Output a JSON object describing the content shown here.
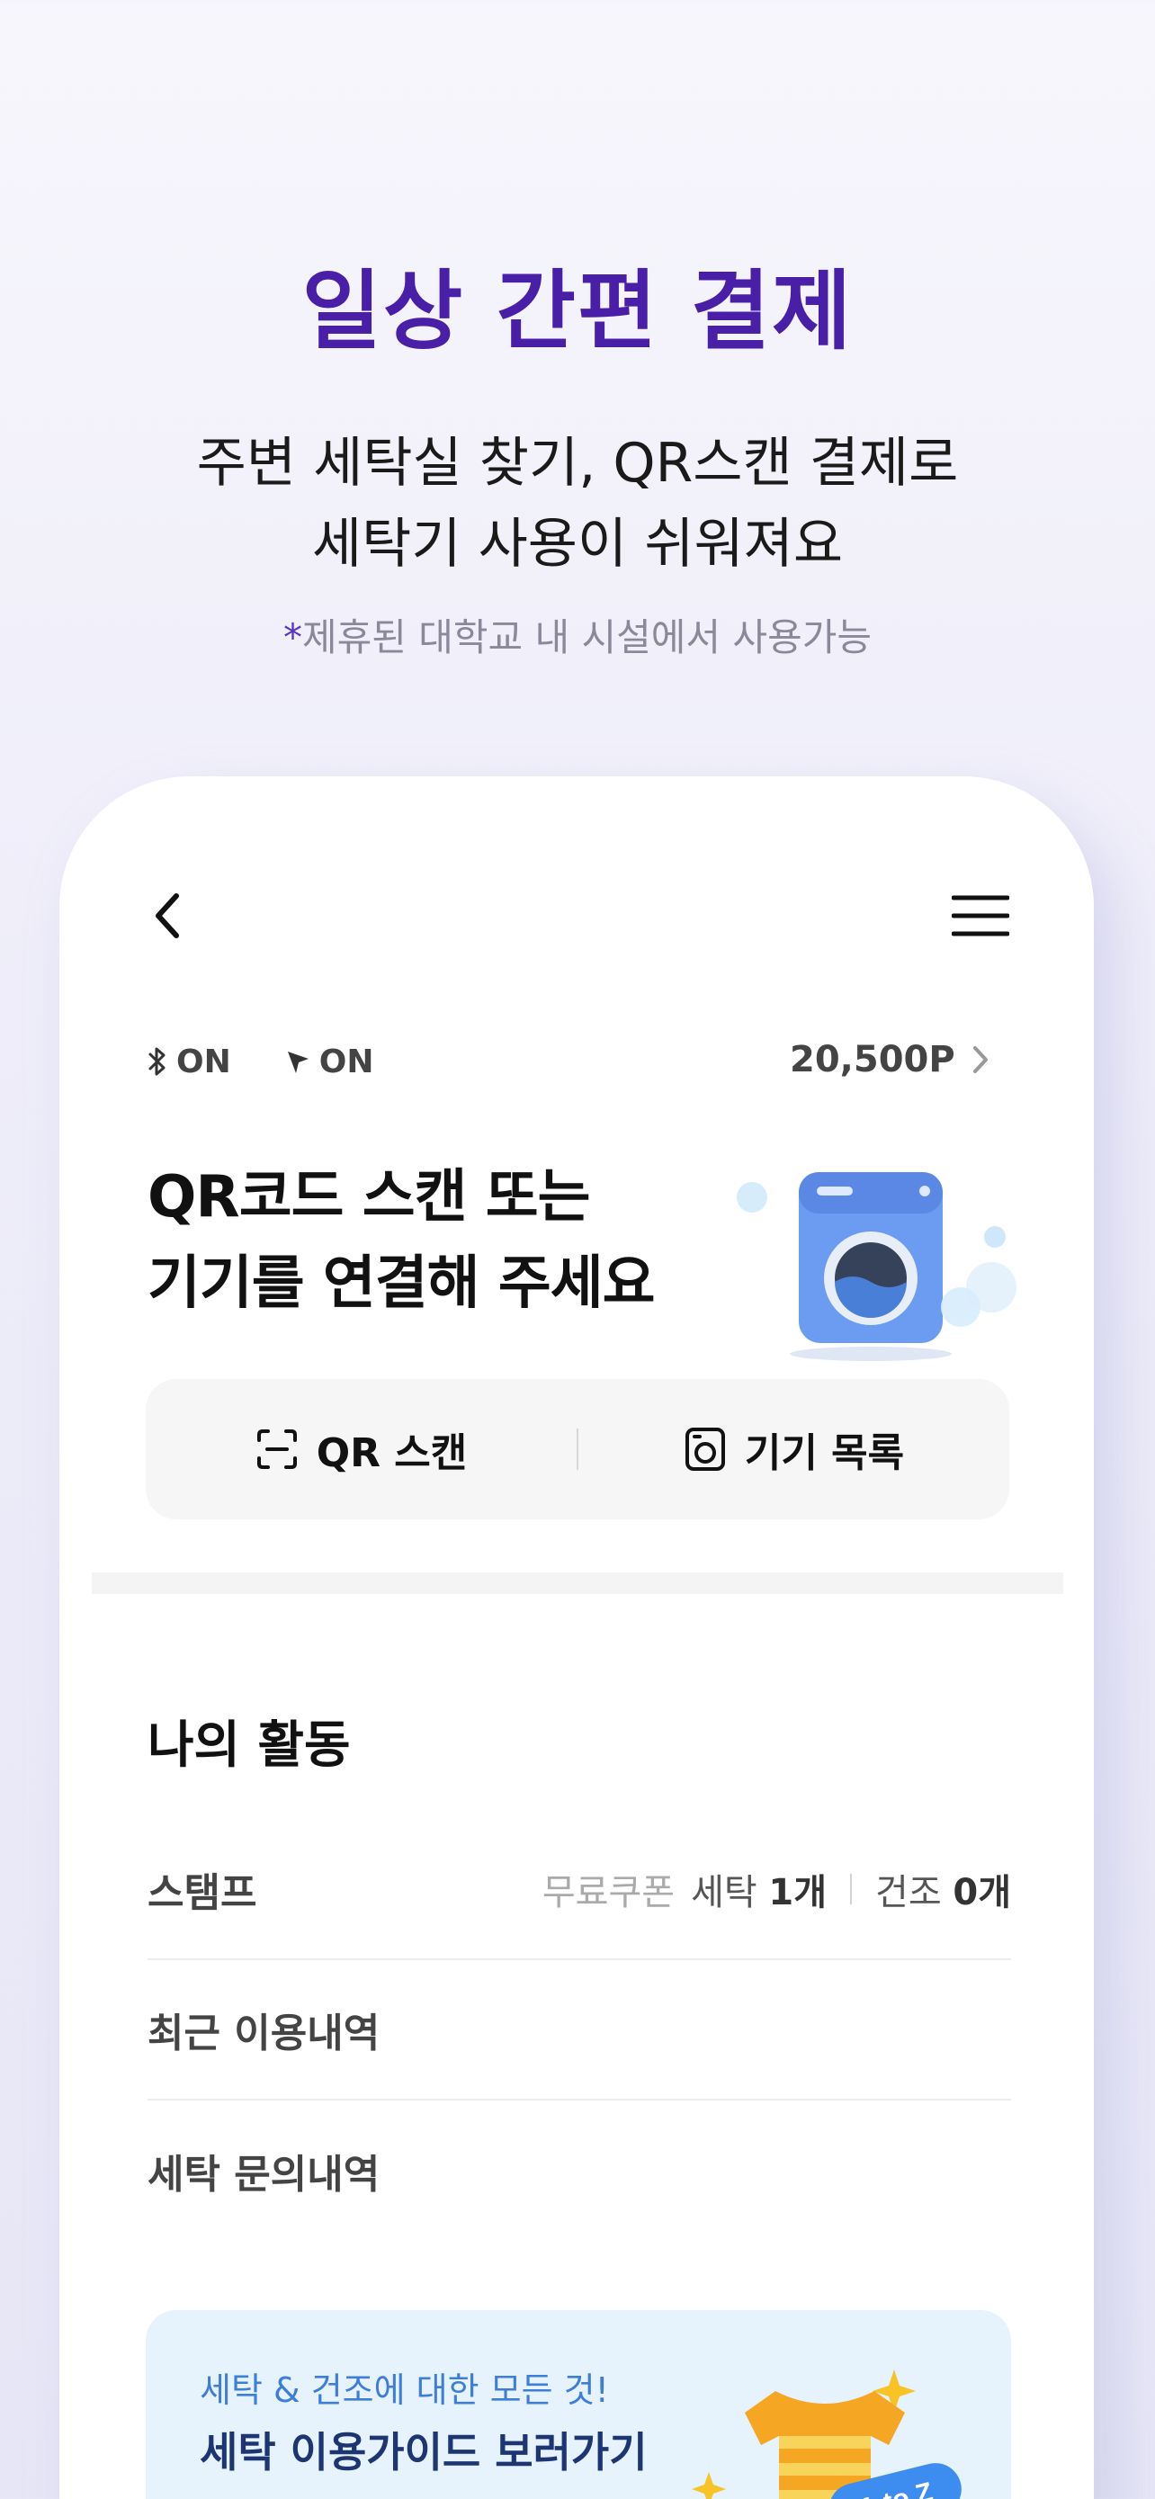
{
  "promo": {
    "title": "일상 간편 결제",
    "subtitle_line1": "주변 세탁실 찾기, QR스캔 결제로",
    "subtitle_line2": "세탁기 사용이 쉬워져요",
    "note_star": "*",
    "note": "제휴된 대학교 내 시설에서 사용가능"
  },
  "header": {
    "back_icon": "chevron-left-icon",
    "menu_icon": "hamburger-menu-icon"
  },
  "status": {
    "bluetooth_label": "ON",
    "location_label": "ON",
    "points": "20,500P"
  },
  "hero": {
    "title_line1": "QR코드 스캔 또는",
    "title_line2": "기기를 연결해 주세요"
  },
  "actions": {
    "qr_scan_label": "QR 스캔",
    "device_list_label": "기기 목록"
  },
  "activity": {
    "title": "나의 활동",
    "stamp_label": "스탬프",
    "free_coupon_label": "무료쿠폰",
    "wash_label": "세탁",
    "wash_count": "1개",
    "dry_label": "건조",
    "dry_count": "0개",
    "recent_usage_label": "최근 이용내역",
    "inquiry_label": "세탁 문의내역"
  },
  "guide": {
    "subtitle": "세탁 & 건조에 대한 모든 것!",
    "title": "세탁 이용가이드 보러가기",
    "badge": "A to Z"
  },
  "colors": {
    "accent_purple": "#4a1fa8",
    "guide_bg": "#e6f2fc",
    "guide_title": "#1d3572",
    "washer_blue": "#5b8ff0"
  }
}
